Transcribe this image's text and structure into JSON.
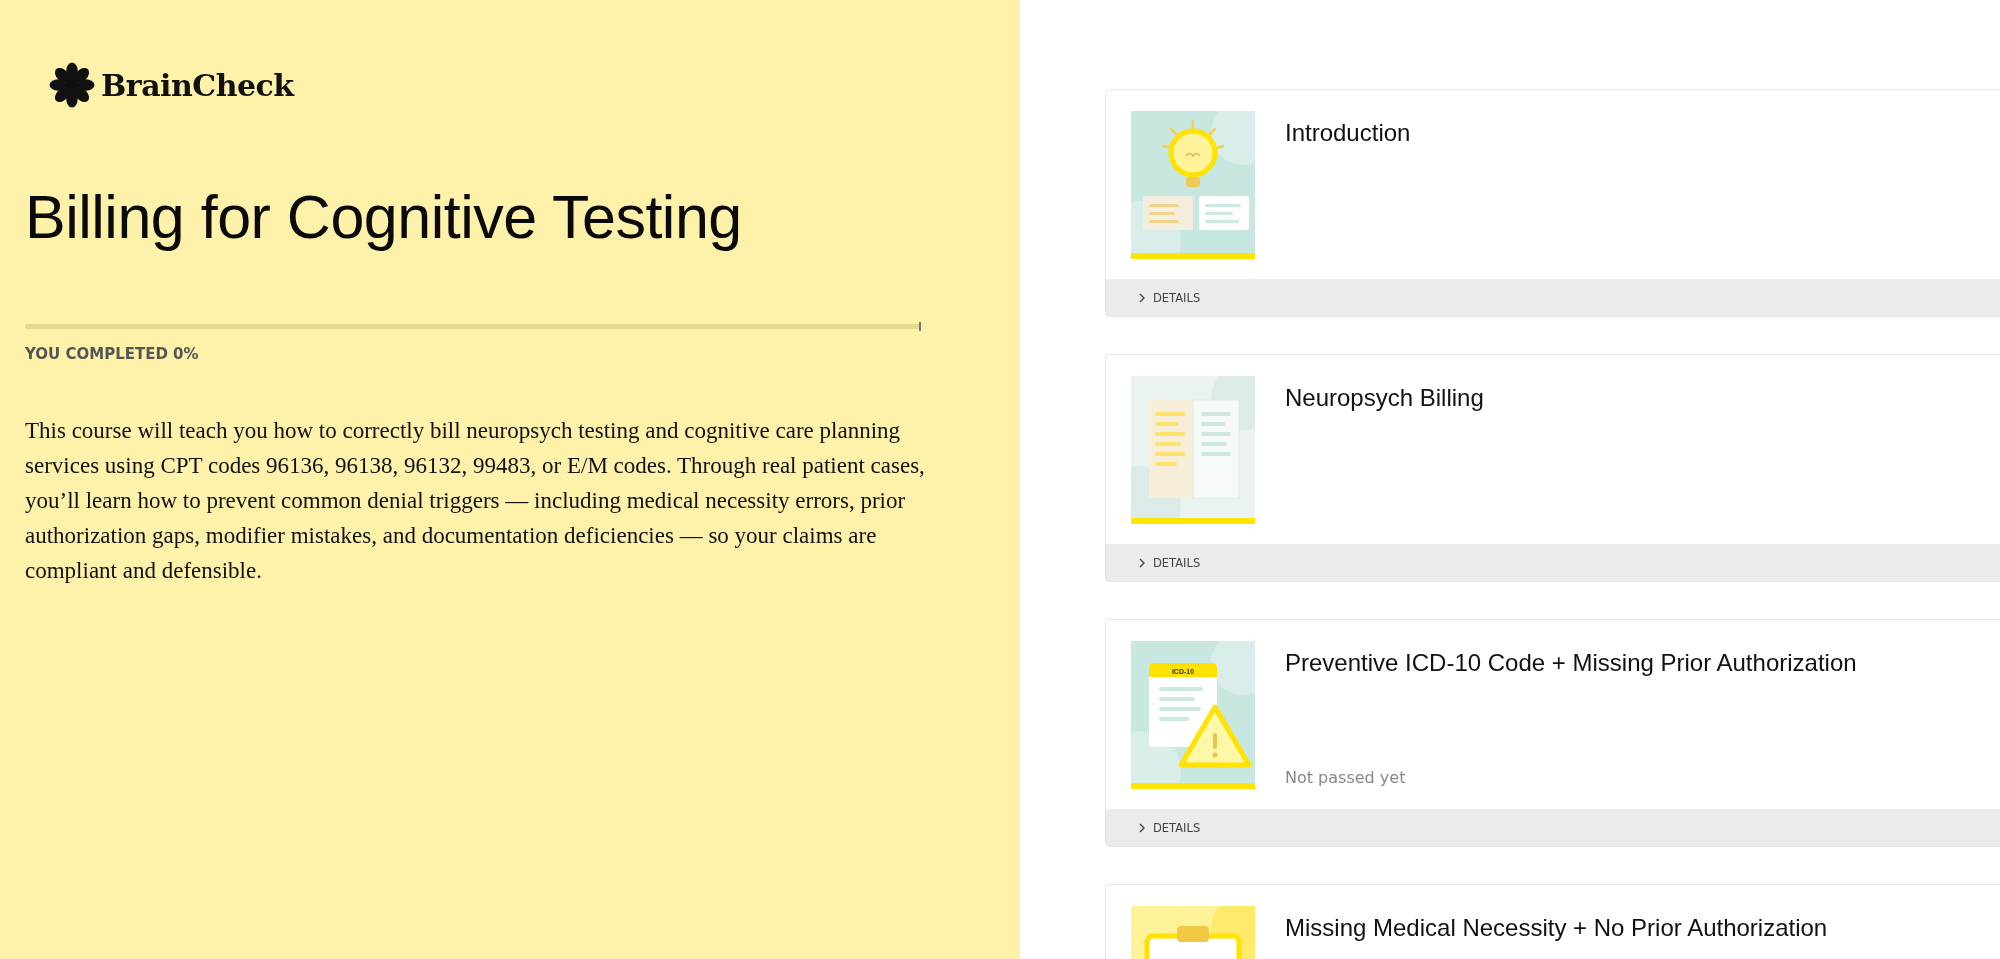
{
  "brand": {
    "name": "BrainCheck"
  },
  "course": {
    "title": "Billing for Cognitive Testing",
    "progress": {
      "level": 0,
      "label": "YOU COMPLETED 0%"
    },
    "description": "This course will teach you how to correctly bill neuropsych testing and cognitive care planning services using CPT codes 96136, 96138, 96132, 99483, or E/M codes. Through real patient cases, you’ll learn how to prevent common denial triggers — including medical necessity errors, prior authorization gaps, modifier mistakes, and documentation deficiencies — so your claims are compliant and defensible."
  },
  "lessons": [
    {
      "title": "Introduction",
      "thumbnail": {
        "kind": "lightbulb"
      },
      "details": {
        "label": "DETAILS",
        "expanded": false
      }
    },
    {
      "title": "Neuropsych Billing",
      "thumbnail": {
        "kind": "book"
      },
      "details": {
        "label": "DETAILS",
        "expanded": false
      }
    },
    {
      "title": "Preventive ICD-10 Code + Missing Prior Authorization",
      "thumbnail": {
        "kind": "warning",
        "label": "ICD-10"
      },
      "status": "Not passed yet",
      "details": {
        "label": "DETAILS",
        "expanded": false
      }
    },
    {
      "title": "Missing Medical Necessity + No Prior Authorization",
      "thumbnail": {
        "kind": "clipboard"
      }
    }
  ]
}
